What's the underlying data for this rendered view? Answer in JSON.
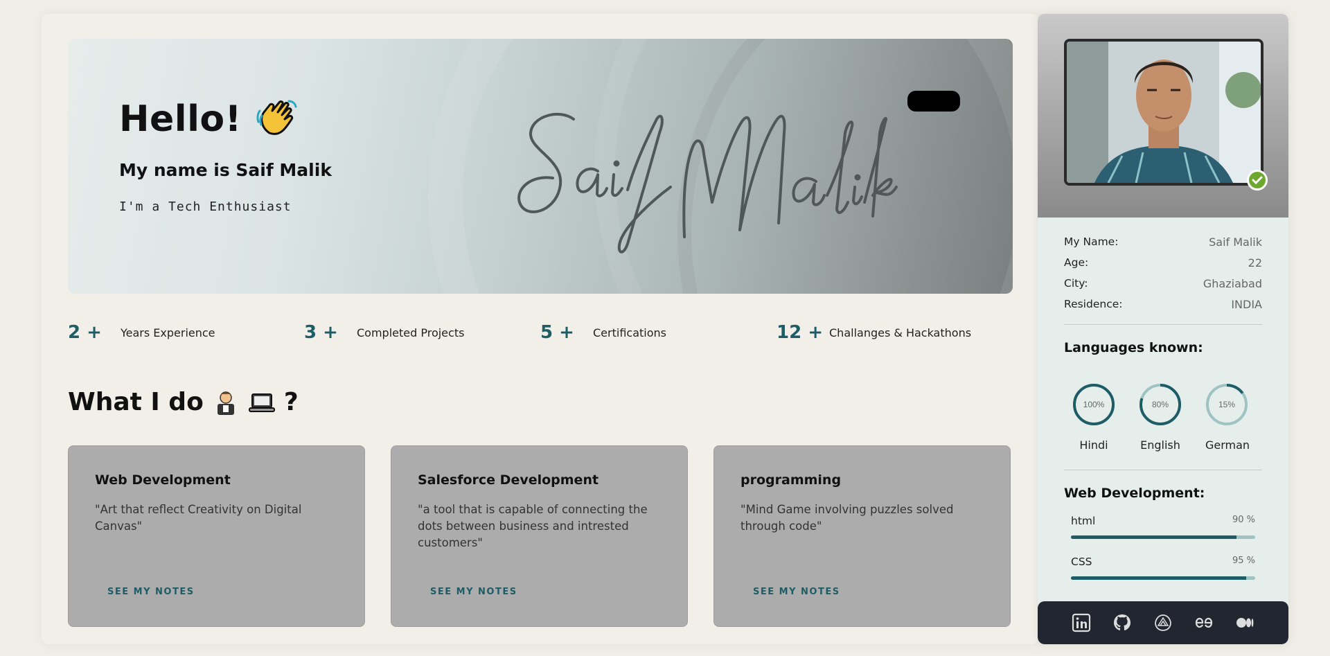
{
  "hero": {
    "greeting": "Hello!",
    "name_line": "My name is Saif Malik",
    "tagline": "I'm a Tech Enthusiast",
    "signature_text": "Saif Malik",
    "wave_icon": "waving-hand-icon"
  },
  "stats": [
    {
      "number": "2 +",
      "label": "Years Experience"
    },
    {
      "number": "3 +",
      "label": "Completed Projects"
    },
    {
      "number": "5 +",
      "label": "Certifications"
    },
    {
      "number": "12 +",
      "label": "Challanges & Hackathons"
    }
  ],
  "what_i_do": {
    "title": "What I do",
    "suffix": "?",
    "icons": [
      "technologist-icon",
      "laptop-icon"
    ]
  },
  "cards": [
    {
      "title": "Web Development",
      "desc": "\"Art that reflect Creativity on Digital Canvas\"",
      "link": "SEE MY NOTES"
    },
    {
      "title": "Salesforce Development",
      "desc": "\"a tool that is capable of connecting the dots between business and intrested customers\"",
      "link": "SEE MY NOTES"
    },
    {
      "title": "programming",
      "desc": "\"Mind Game involving puzzles solved through code\"",
      "link": "SEE MY NOTES"
    }
  ],
  "profile": {
    "info": [
      {
        "key": "My Name:",
        "value": "Saif Malik"
      },
      {
        "key": "Age:",
        "value": "22"
      },
      {
        "key": "City:",
        "value": "Ghaziabad"
      },
      {
        "key": "Residence:",
        "value": "INDIA"
      }
    ],
    "languages_heading": "Languages known:",
    "languages": [
      {
        "name": "Hindi",
        "percent": 100,
        "label": "100%"
      },
      {
        "name": "English",
        "percent": 80,
        "label": "80%"
      },
      {
        "name": "German",
        "percent": 15,
        "label": "15%"
      }
    ],
    "skills_heading": "Web Development:",
    "skills": [
      {
        "name": "html",
        "percent": 90,
        "label": "90 %"
      },
      {
        "name": "CSS",
        "percent": 95,
        "label": "95 %"
      }
    ]
  },
  "social": [
    "linkedin-icon",
    "github-icon",
    "codechef-icon",
    "geeksforgeeks-icon",
    "medium-icon"
  ],
  "colors": {
    "accent": "#1e5c66",
    "card_bg": "#acacac",
    "sidebar_bg": "#e6eeec",
    "social_bg": "#222631",
    "verified": "#6ea82f"
  }
}
